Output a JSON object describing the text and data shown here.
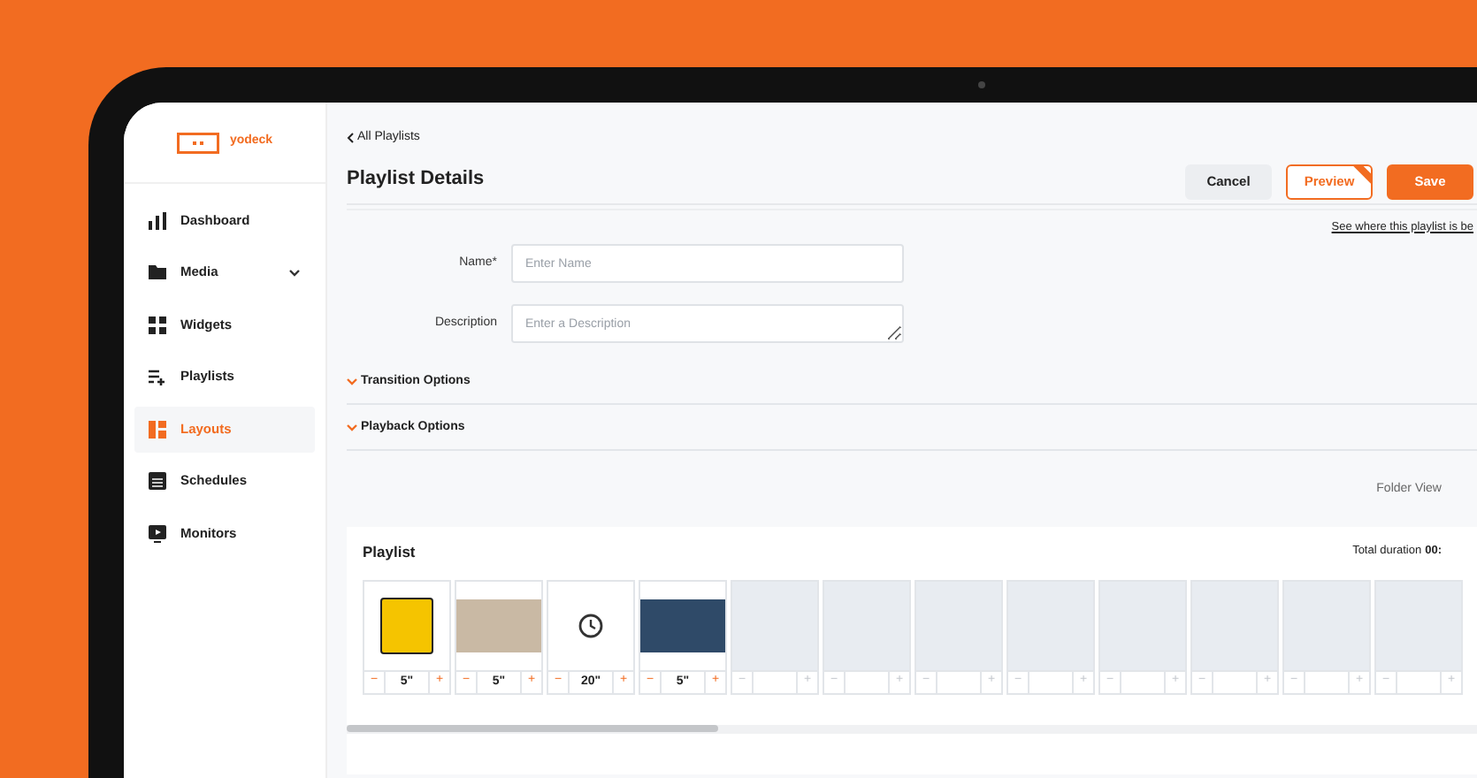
{
  "sidebar": {
    "logo_text": "yodeck",
    "items": [
      {
        "label": "Dashboard",
        "selected": false,
        "expandable": false
      },
      {
        "label": "Media",
        "selected": false,
        "expandable": true
      },
      {
        "label": "Widgets",
        "selected": false,
        "expandable": false
      },
      {
        "label": "Playlists",
        "selected": false,
        "expandable": false
      },
      {
        "label": "Layouts",
        "selected": true,
        "expandable": false
      },
      {
        "label": "Schedules",
        "selected": false,
        "expandable": false
      },
      {
        "label": "Monitors",
        "selected": false,
        "expandable": false
      }
    ]
  },
  "back_link": "All Playlists",
  "title": "Playlist Details",
  "buttons": [
    {
      "label": "Cancel",
      "kind": "secondary"
    },
    {
      "label": "Preview",
      "kind": "outline"
    },
    {
      "label": "Save",
      "kind": "primary"
    }
  ],
  "usage_link": "See where this playlist is be",
  "form": [
    {
      "label": "Name*",
      "placeholder": "Enter Name",
      "kind": "input"
    },
    {
      "label": "Description",
      "placeholder": "Enter a Description",
      "kind": "textarea"
    }
  ],
  "sections": [
    {
      "label": "Transition Options"
    },
    {
      "label": "Playback Options"
    }
  ],
  "folder_view": "Folder View",
  "playlist": {
    "title": "Playlist",
    "total_label": "Total duration",
    "total_value": "00:",
    "slots": [
      {
        "kind": "sign",
        "duration": "5\"",
        "minus": "−",
        "plus": "+"
      },
      {
        "kind": "photo",
        "duration": "5\"",
        "minus": "−",
        "plus": "+"
      },
      {
        "kind": "clock",
        "duration": "20\"",
        "minus": "−",
        "plus": "+"
      },
      {
        "kind": "photo",
        "duration": "5\"",
        "minus": "−",
        "plus": "+"
      },
      {
        "kind": "empty",
        "minus": "−",
        "plus": "+"
      },
      {
        "kind": "empty",
        "minus": "−",
        "plus": "+"
      },
      {
        "kind": "empty",
        "minus": "−",
        "plus": "+"
      },
      {
        "kind": "empty",
        "minus": "−",
        "plus": "+"
      },
      {
        "kind": "empty",
        "minus": "−",
        "plus": "+"
      },
      {
        "kind": "empty",
        "minus": "−",
        "plus": "+"
      },
      {
        "kind": "empty",
        "minus": "−",
        "plus": "+"
      },
      {
        "kind": "empty",
        "minus": "−",
        "plus": "+"
      }
    ]
  }
}
